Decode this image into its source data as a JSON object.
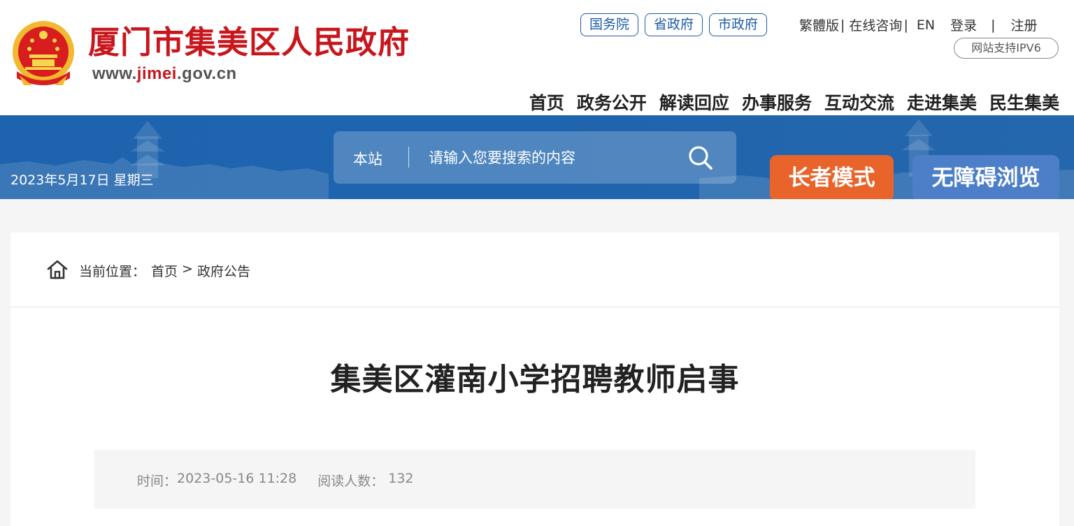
{
  "header": {
    "site_title": "厦门市集美区人民政府",
    "site_url_prefix": "www.",
    "site_url_highlight": "jimei",
    "site_url_suffix": ".gov.cn",
    "gov_links": [
      "国务院",
      "省政府",
      "市政府"
    ],
    "util_links": {
      "traditional": "繁體版",
      "consult": "在线咨询",
      "english": "EN",
      "login": "登录",
      "register": "注册",
      "separator": "|"
    },
    "ipv6_badge": "网站支持IPV6",
    "nav": [
      "首页",
      "政务公开",
      "解读回应",
      "办事服务",
      "互动交流",
      "走进集美",
      "民生集美"
    ]
  },
  "banner": {
    "date": "2023年5月17日 星期三",
    "search": {
      "scope": "本站",
      "placeholder": "请输入您要搜索的内容"
    },
    "elder_mode_label": "长者模式",
    "accessible_label": "无障碍浏览"
  },
  "breadcrumb": {
    "prefix": "当前位置：",
    "items": [
      "首页",
      "政府公告"
    ],
    "separator": ">"
  },
  "article": {
    "title": "集美区灌南小学招聘教师启事",
    "time_label": "时间：",
    "time_value": "2023-05-16 11:28",
    "views_label": "阅读人数：",
    "views_value": "132"
  },
  "colors": {
    "brand_red": "#c8161d",
    "banner_blue": "#1e63ad",
    "link_blue": "#1d5ba6",
    "elder_orange": "#e8642a",
    "access_blue": "#4d7fc8"
  }
}
